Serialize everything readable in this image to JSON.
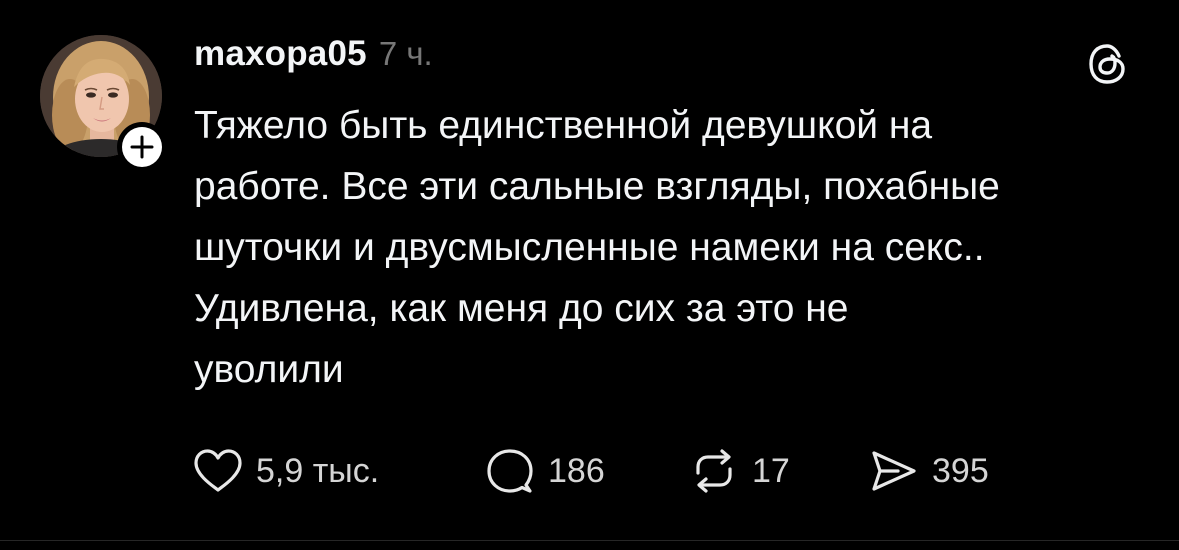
{
  "post": {
    "username": "maxopa05",
    "time": "7 ч.",
    "paragraphs": [
      "Тяжело быть единственной девушкой на работе. Все эти сальные взгляды, похабные шуточки и двусмысленные намеки на секс..",
      "Удивлена, как меня до сих за это не уволили"
    ],
    "lines": [
      "Тяжело быть единственной девушкой на",
      "работе. Все эти сальные взгляды, похабные",
      "шуточки и двусмысленные намеки на секс..",
      "Удивлена, как меня до сих за это не",
      "уволили"
    ]
  },
  "actions": {
    "likes": "5,9 тыс.",
    "replies": "186",
    "reposts": "17",
    "shares": "395"
  },
  "icons": {
    "avatar": "profile-photo",
    "follow": "plus-icon",
    "brand": "threads-logo-icon",
    "like": "heart-icon",
    "reply": "speech-bubble-icon",
    "repost": "repost-arrows-icon",
    "share": "paper-plane-icon"
  },
  "colors": {
    "background": "#000000",
    "text": "#f3f5f7",
    "muted": "#777777",
    "counts": "#d5d5d5"
  }
}
